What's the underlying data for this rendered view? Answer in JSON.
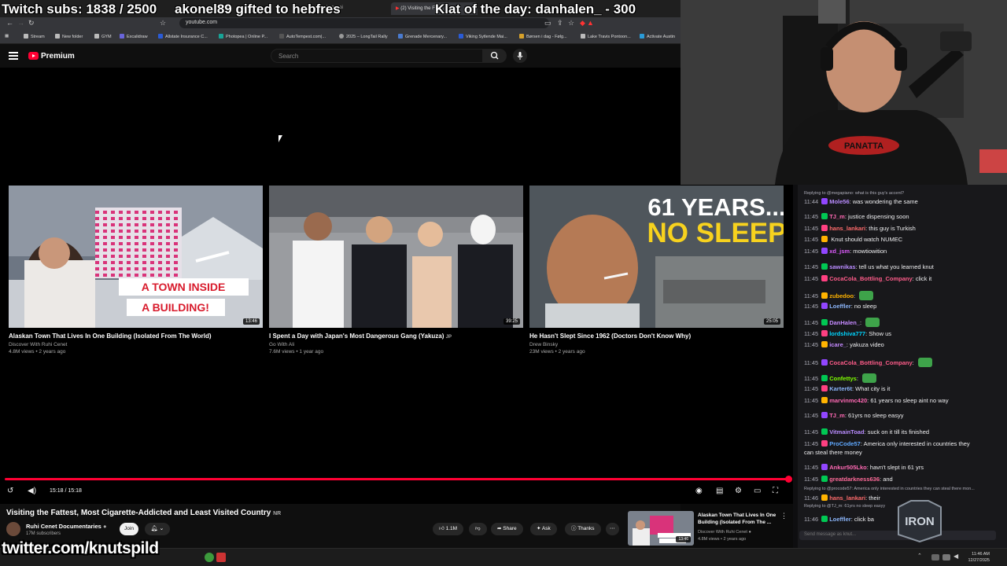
{
  "overlay": {
    "subs": "Twitch subs: 1838 / 2500",
    "gift": "akonel89 gifted to hebfres",
    "klat": "Klat of the day: danhalen_ - 300"
  },
  "browser": {
    "tabs": [
      "t'es chez moi",
      "(2) Visiting the Fatt..."
    ],
    "url": "youtube.com",
    "bookmarks": [
      "Stream",
      "New folder",
      "GYM",
      "Excalidraw",
      "Allstate Insurance C...",
      "Photopea | Online P...",
      "AutoTempest.com|...",
      "2025 – LongTail Rally",
      "Grenade Mercenary...",
      "Viking Sytlende Mai...",
      "Børsen i dag - Følg...",
      "Lake Travis Pontoon...",
      "Activate Austin"
    ]
  },
  "youtube": {
    "brand": "Premium",
    "search_placeholder": "Search"
  },
  "endscreen": [
    {
      "title": "Alaskan Town That Lives In One Building (Isolated From The World)",
      "channel": "Discover With Ruhi Cenet",
      "meta": "4.8M views • 2 years ago",
      "duration": "13:46",
      "overlay_text": "A TOWN INSIDE A BUILDING!"
    },
    {
      "title": "I Spent a Day with Japan's Most Dangerous Gang (Yakuza)",
      "title_badge": "JP",
      "channel": "Go With Ali",
      "meta": "7.6M views • 1 year ago",
      "duration": "39:25"
    },
    {
      "title": "He Hasn't Slept Since 1962 (Doctors Don't Know Why)",
      "channel": "Drew Binsky",
      "meta": "23M views • 2 years ago",
      "duration": "25:05",
      "overlay_text_1": "61 YEARS...",
      "overlay_text_2": "NO SLEEP"
    }
  ],
  "player": {
    "time": "15:18 / 15:18",
    "progress": 1.0
  },
  "video": {
    "title": "Visiting the Fattest, Most Cigarette-Addicted and Least Visited Country",
    "title_badge": "NR",
    "channel": "Ruhi Cenet Documentaries",
    "subs": "17M subscribers",
    "join": "Join",
    "likes": "1.1M",
    "share": "Share",
    "ask": "Ask",
    "thanks": "Thanks"
  },
  "recommended": {
    "title": "Alaskan Town That Lives In One Building (Isolated From The ...",
    "channel": "Discover With Ruhi Cenet",
    "meta": "4.8M views • 2 years ago",
    "duration": "13:46"
  },
  "watermark": "twitter.com/knutspild",
  "webcam": {
    "shirt_text": "PANATTA"
  },
  "chat": {
    "messages": [
      {
        "reply": "Replying to @megapiano: what is this guy's accent?"
      },
      {
        "time": "11:44",
        "user": "Mole56",
        "color": "#b98cff",
        "text": "was wondering the same"
      },
      {
        "time": "11:45",
        "user": "TJ_m",
        "color": "#ff69b4",
        "text": "justice dispensing soon"
      },
      {
        "time": "11:45",
        "user": "hans_lankari",
        "color": "#ff6b6b",
        "text": "this guy is Turkish"
      },
      {
        "time": "11:45",
        "user": "",
        "color": "#ff4444",
        "text": "Knut should watch NUMEC"
      },
      {
        "time": "11:45",
        "user": "xd_jsm",
        "color": "#e05cff",
        "text": "mowtiowition"
      },
      {
        "time": "11:45",
        "user": "sawnikas",
        "color": "#b98cff",
        "text": "tell us what you learned knut"
      },
      {
        "time": "11:45",
        "user": "CocaCola_Bottling_Company",
        "color": "#ff5c8a",
        "text": "click it"
      },
      {
        "time": "11:45",
        "user": "zubedoo",
        "color": "#ffb300",
        "text": ""
      },
      {
        "time": "11:45",
        "user": "Loeffler",
        "color": "#8ab4f8",
        "text": "no sleep"
      },
      {
        "time": "11:45",
        "user": "DanHalen_",
        "color": "#c58aff",
        "text": ""
      },
      {
        "time": "11:45",
        "user": "lordshiva777",
        "color": "#00d5ff",
        "text": "Show us"
      },
      {
        "time": "11:45",
        "user": "icare_",
        "color": "#c58aff",
        "text": "yakuza video"
      },
      {
        "time": "11:45",
        "user": "CocaCola_Bottling_Company",
        "color": "#ff5c8a",
        "text": ""
      },
      {
        "time": "11:45",
        "user": "Confettys",
        "color": "#7fff00",
        "text": ""
      },
      {
        "time": "11:45",
        "user": "Karter6t",
        "color": "#8ab4f8",
        "text": "What city is it"
      },
      {
        "time": "11:45",
        "user": "marvinmc420",
        "color": "#ff69b4",
        "text": "61 years no sleep aint no way"
      },
      {
        "time": "11:45",
        "user": "TJ_m",
        "color": "#ff69b4",
        "text": "61yrs no sleep easyy"
      },
      {
        "time": "11:45",
        "user": "VitmainToad",
        "color": "#b98cff",
        "text": "suck on it till its finished"
      },
      {
        "time": "11:45",
        "user": "ProCode57",
        "color": "#5fa8ff",
        "text": "America only interested in countries they"
      },
      {
        "text_cont": "can steal there money"
      },
      {
        "time": "11:45",
        "user": "Ankur505Lko",
        "color": "#ff69b4",
        "text": "havn't slept in 61 yrs"
      },
      {
        "time": "11:45",
        "user": "greatdarkness636",
        "color": "#ff6b9a",
        "text": "and"
      },
      {
        "reply": "Replying to @procode57: America only interested in countries they can steal there mon..."
      },
      {
        "time": "11:46",
        "user": "hans_lankari",
        "color": "#ff6b6b",
        "text": "their"
      },
      {
        "reply": "Replying to @TJ_m: 61yrs no sleep easyy"
      },
      {
        "time": "11:46",
        "user": "Loeffler",
        "color": "#8ab4f8",
        "text": "click ba"
      }
    ],
    "input_placeholder": "Send message as knut...",
    "logo_text": "IRON"
  },
  "taskbar": {
    "time": "11:46 AM",
    "date": "12/27/2025"
  }
}
